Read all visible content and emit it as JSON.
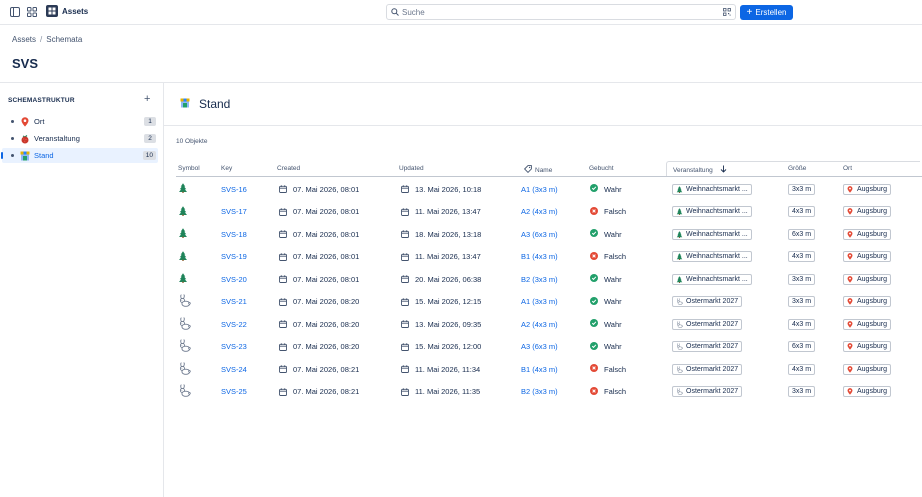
{
  "app": {
    "name": "Assets"
  },
  "search": {
    "placeholder": "Suche"
  },
  "create_button": {
    "label": "Erstellen"
  },
  "breadcrumb": {
    "items": [
      "Assets",
      "Schemata"
    ],
    "separator": "/"
  },
  "page": {
    "title": "SVS"
  },
  "sidebar": {
    "heading": "SCHEMASTRUKTUR",
    "items": [
      {
        "label": "Ort",
        "count": "1",
        "icon": "map-pin-icon",
        "active": false
      },
      {
        "label": "Veranstaltung",
        "count": "2",
        "icon": "raspberry-icon",
        "active": false
      },
      {
        "label": "Stand",
        "count": "10",
        "icon": "stall-icon",
        "active": true
      }
    ]
  },
  "main": {
    "title": "Stand",
    "object_count": "10 Objekte"
  },
  "table": {
    "columns": {
      "symbol": "Symbol",
      "key": "Key",
      "created": "Created",
      "updated": "Updated",
      "name": "Name",
      "gebucht": "Gebucht",
      "veranstaltung": "Veranstaltung",
      "groesse": "Größe",
      "ort": "Ort"
    },
    "rows": [
      {
        "symbol": "tree-icon",
        "key": "SVS-16",
        "created": "07. Mai 2026, 08:01",
        "updated": "13. Mai 2026, 10:18",
        "name": "A1 (3x3 m)",
        "gebucht": "Wahr",
        "booked": true,
        "event": "Weihnachtsmarkt ...",
        "event_icon": "tree-icon",
        "size": "3x3 m",
        "ort": "Augsburg"
      },
      {
        "symbol": "tree-icon",
        "key": "SVS-17",
        "created": "07. Mai 2026, 08:01",
        "updated": "11. Mai 2026, 13:47",
        "name": "A2 (4x3 m)",
        "gebucht": "Falsch",
        "booked": false,
        "event": "Weihnachtsmarkt ...",
        "event_icon": "tree-icon",
        "size": "4x3 m",
        "ort": "Augsburg"
      },
      {
        "symbol": "tree-icon",
        "key": "SVS-18",
        "created": "07. Mai 2026, 08:01",
        "updated": "18. Mai 2026, 13:18",
        "name": "A3 (6x3 m)",
        "gebucht": "Wahr",
        "booked": true,
        "event": "Weihnachtsmarkt ...",
        "event_icon": "tree-icon",
        "size": "6x3 m",
        "ort": "Augsburg"
      },
      {
        "symbol": "tree-icon",
        "key": "SVS-19",
        "created": "07. Mai 2026, 08:01",
        "updated": "11. Mai 2026, 13:47",
        "name": "B1 (4x3 m)",
        "gebucht": "Falsch",
        "booked": false,
        "event": "Weihnachtsmarkt ...",
        "event_icon": "tree-icon",
        "size": "4x3 m",
        "ort": "Augsburg"
      },
      {
        "symbol": "tree-icon",
        "key": "SVS-20",
        "created": "07. Mai 2026, 08:01",
        "updated": "20. Mai 2026, 06:38",
        "name": "B2 (3x3 m)",
        "gebucht": "Wahr",
        "booked": true,
        "event": "Weihnachtsmarkt ...",
        "event_icon": "tree-icon",
        "size": "3x3 m",
        "ort": "Augsburg"
      },
      {
        "symbol": "rabbit-icon",
        "key": "SVS-21",
        "created": "07. Mai 2026, 08:20",
        "updated": "15. Mai 2026, 12:15",
        "name": "A1 (3x3 m)",
        "gebucht": "Wahr",
        "booked": true,
        "event": "Ostermarkt 2027",
        "event_icon": "rabbit-icon",
        "size": "3x3 m",
        "ort": "Augsburg"
      },
      {
        "symbol": "rabbit-icon",
        "key": "SVS-22",
        "created": "07. Mai 2026, 08:20",
        "updated": "13. Mai 2026, 09:35",
        "name": "A2 (4x3 m)",
        "gebucht": "Wahr",
        "booked": true,
        "event": "Ostermarkt 2027",
        "event_icon": "rabbit-icon",
        "size": "4x3 m",
        "ort": "Augsburg"
      },
      {
        "symbol": "rabbit-icon",
        "key": "SVS-23",
        "created": "07. Mai 2026, 08:20",
        "updated": "15. Mai 2026, 12:00",
        "name": "A3 (6x3 m)",
        "gebucht": "Wahr",
        "booked": true,
        "event": "Ostermarkt 2027",
        "event_icon": "rabbit-icon",
        "size": "6x3 m",
        "ort": "Augsburg"
      },
      {
        "symbol": "rabbit-icon",
        "key": "SVS-24",
        "created": "07. Mai 2026, 08:21",
        "updated": "11. Mai 2026, 11:34",
        "name": "B1 (4x3 m)",
        "gebucht": "Falsch",
        "booked": false,
        "event": "Ostermarkt 2027",
        "event_icon": "rabbit-icon",
        "size": "4x3 m",
        "ort": "Augsburg"
      },
      {
        "symbol": "rabbit-icon",
        "key": "SVS-25",
        "created": "07. Mai 2026, 08:21",
        "updated": "11. Mai 2026, 11:35",
        "name": "B2 (3x3 m)",
        "gebucht": "Falsch",
        "booked": false,
        "event": "Ostermarkt 2027",
        "event_icon": "rabbit-icon",
        "size": "3x3 m",
        "ort": "Augsburg"
      }
    ]
  },
  "colors": {
    "accent": "#0c66e4",
    "true": "#22a06b",
    "false": "#e34935",
    "tree": "#1f845a",
    "pin": "#e34935"
  }
}
